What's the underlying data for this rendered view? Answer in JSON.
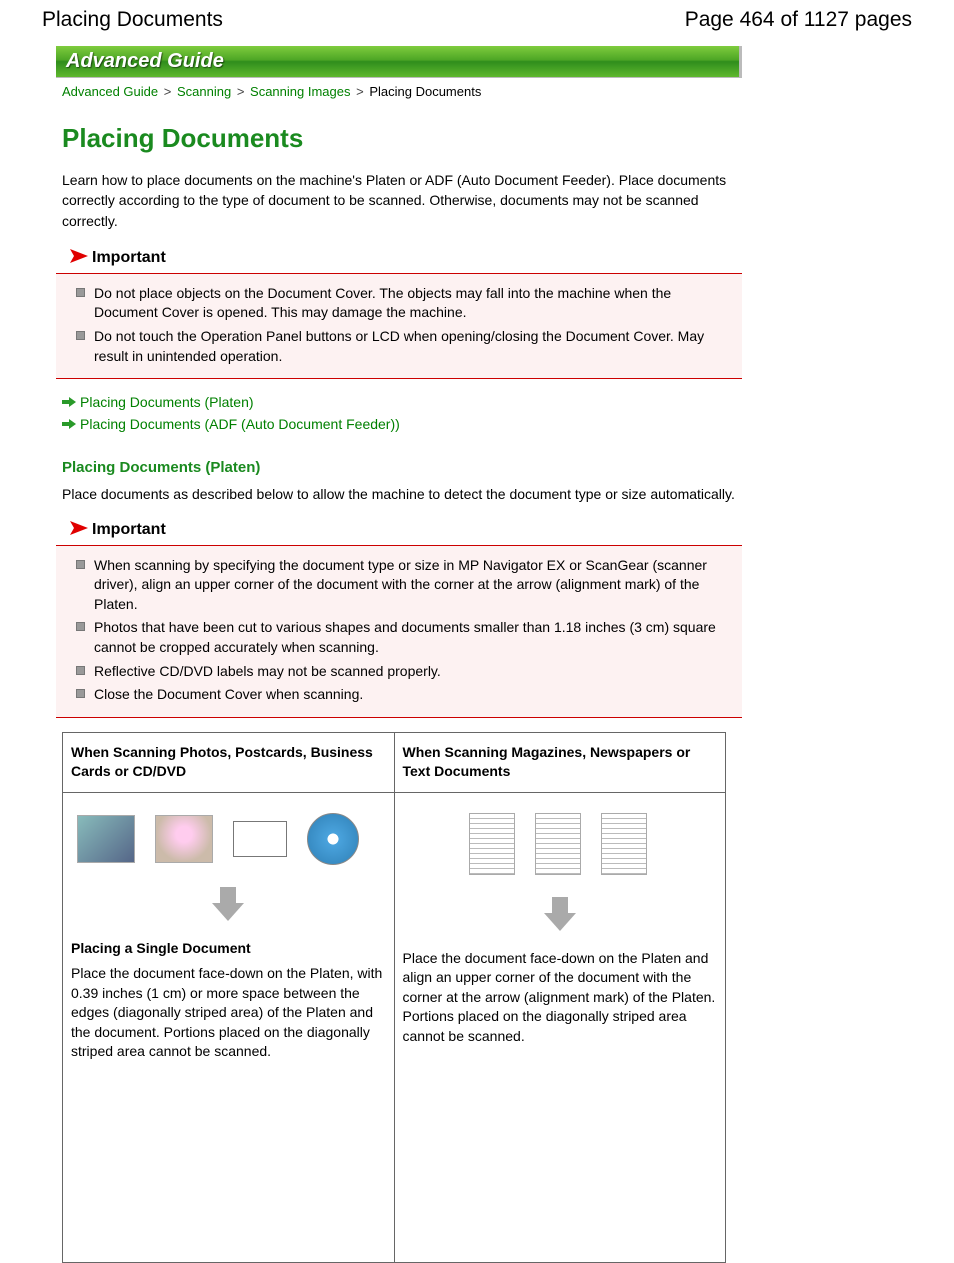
{
  "header": {
    "doc_title": "Placing Documents",
    "page_indicator": "Page 464 of 1127 pages"
  },
  "banner": {
    "title": "Advanced Guide"
  },
  "breadcrumb": {
    "items": [
      "Advanced Guide",
      "Scanning",
      "Scanning Images"
    ],
    "current": "Placing Documents",
    "separator": ">"
  },
  "main": {
    "title": "Placing Documents",
    "intro": "Learn how to place documents on the machine's Platen or ADF (Auto Document Feeder). Place documents correctly according to the type of document to be scanned. Otherwise, documents may not be scanned correctly."
  },
  "important1": {
    "label": "Important",
    "items": [
      "Do not place objects on the Document Cover. The objects may fall into the machine when the Document Cover is opened. This may damage the machine.",
      "Do not touch the Operation Panel buttons or LCD when opening/closing the Document Cover. May result in unintended operation."
    ]
  },
  "quicklinks": {
    "items": [
      "Placing Documents (Platen)",
      "Placing Documents (ADF (Auto Document Feeder))"
    ]
  },
  "section_platen": {
    "heading": "Placing Documents (Platen)",
    "text": "Place documents as described below to allow the machine to detect the document type or size automatically."
  },
  "important2": {
    "label": "Important",
    "items": [
      "When scanning by specifying the document type or size in MP Navigator EX or ScanGear (scanner driver), align an upper corner of the document with the corner at the arrow (alignment mark) of the Platen.",
      "Photos that have been cut to various shapes and documents smaller than 1.18 inches (3 cm) square cannot be cropped accurately when scanning.",
      "Reflective CD/DVD labels may not be scanned properly.",
      "Close the Document Cover when scanning."
    ]
  },
  "table": {
    "col1": {
      "header": "When Scanning Photos, Postcards, Business Cards or CD/DVD",
      "subtitle": "Placing a Single Document",
      "body": "Place the document face-down on the Platen, with 0.39 inches (1 cm) or more space between the edges (diagonally striped area) of the Platen and the document. Portions placed on the diagonally striped area cannot be scanned."
    },
    "col2": {
      "header": "When Scanning Magazines, Newspapers or Text Documents",
      "body": "Place the document face-down on the Platen and align an upper corner of the document with the corner at the arrow (alignment mark) of the Platen. Portions placed on the diagonally striped area cannot be scanned."
    }
  }
}
